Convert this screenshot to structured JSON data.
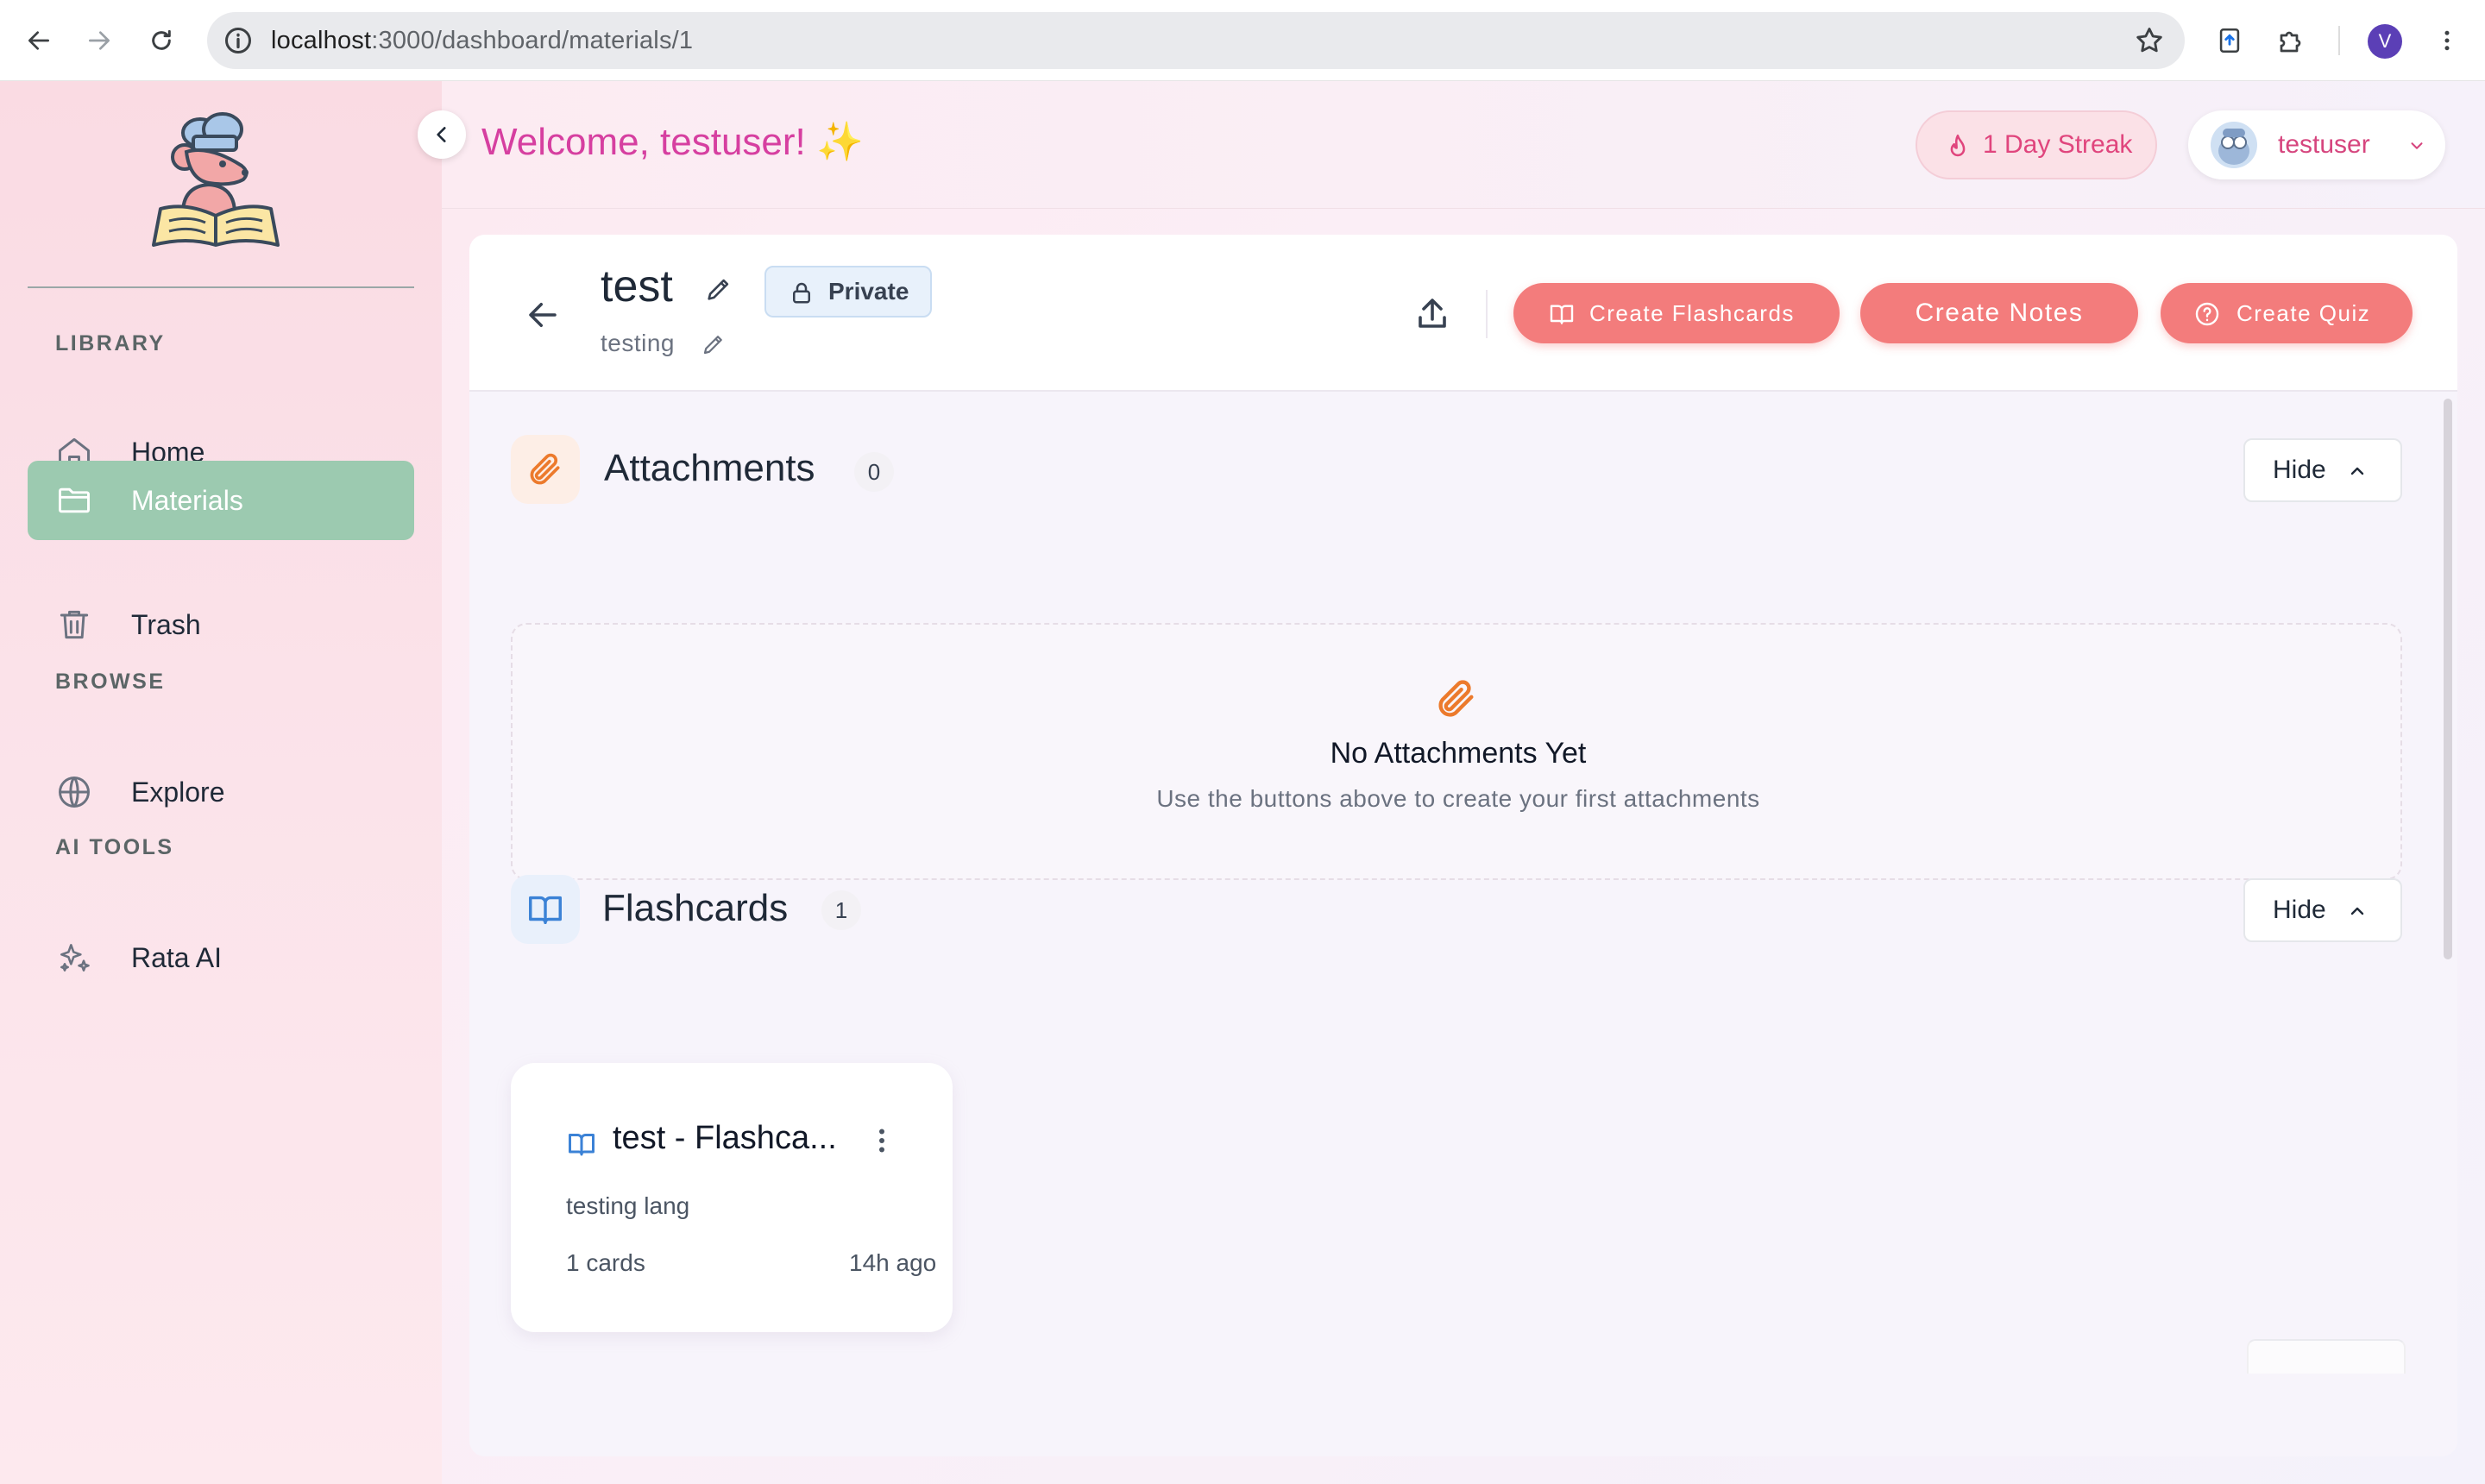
{
  "browser": {
    "url_host": "localhost",
    "url_path": ":3000/dashboard/materials/1",
    "profile_initial": "V"
  },
  "sidebar": {
    "sections": [
      {
        "heading": "LIBRARY",
        "items": [
          {
            "label": "Home",
            "icon": "home-icon"
          },
          {
            "label": "Materials",
            "icon": "folder-icon",
            "active": true
          },
          {
            "label": "Trash",
            "icon": "trash-icon"
          }
        ]
      },
      {
        "heading": "BROWSE",
        "items": [
          {
            "label": "Explore",
            "icon": "globe-icon"
          }
        ]
      },
      {
        "heading": "AI TOOLS",
        "items": [
          {
            "label": "Rata AI",
            "icon": "sparkles-icon"
          }
        ]
      }
    ]
  },
  "topbar": {
    "welcome": "Welcome, testuser! ✨",
    "streak": "1 Day Streak",
    "username": "testuser"
  },
  "material": {
    "title": "test",
    "visibility": "Private",
    "description": "testing"
  },
  "actions": {
    "create_flashcards": "Create Flashcards",
    "create_notes": "Create Notes",
    "create_quiz": "Create Quiz"
  },
  "attachments": {
    "title": "Attachments",
    "count": "0",
    "hide_label": "Hide",
    "empty_title": "No Attachments Yet",
    "empty_subtitle": "Use the buttons above to create your first attachments"
  },
  "flashcards": {
    "title": "Flashcards",
    "count": "1",
    "hide_label": "Hide",
    "items": [
      {
        "title": "test - Flashca...",
        "description": "testing lang",
        "card_count": "1 cards",
        "updated": "14h ago"
      }
    ]
  },
  "colors": {
    "accent_pink": "#d63fa0",
    "action_coral": "#f37c7c",
    "active_green": "#9ccab0"
  }
}
